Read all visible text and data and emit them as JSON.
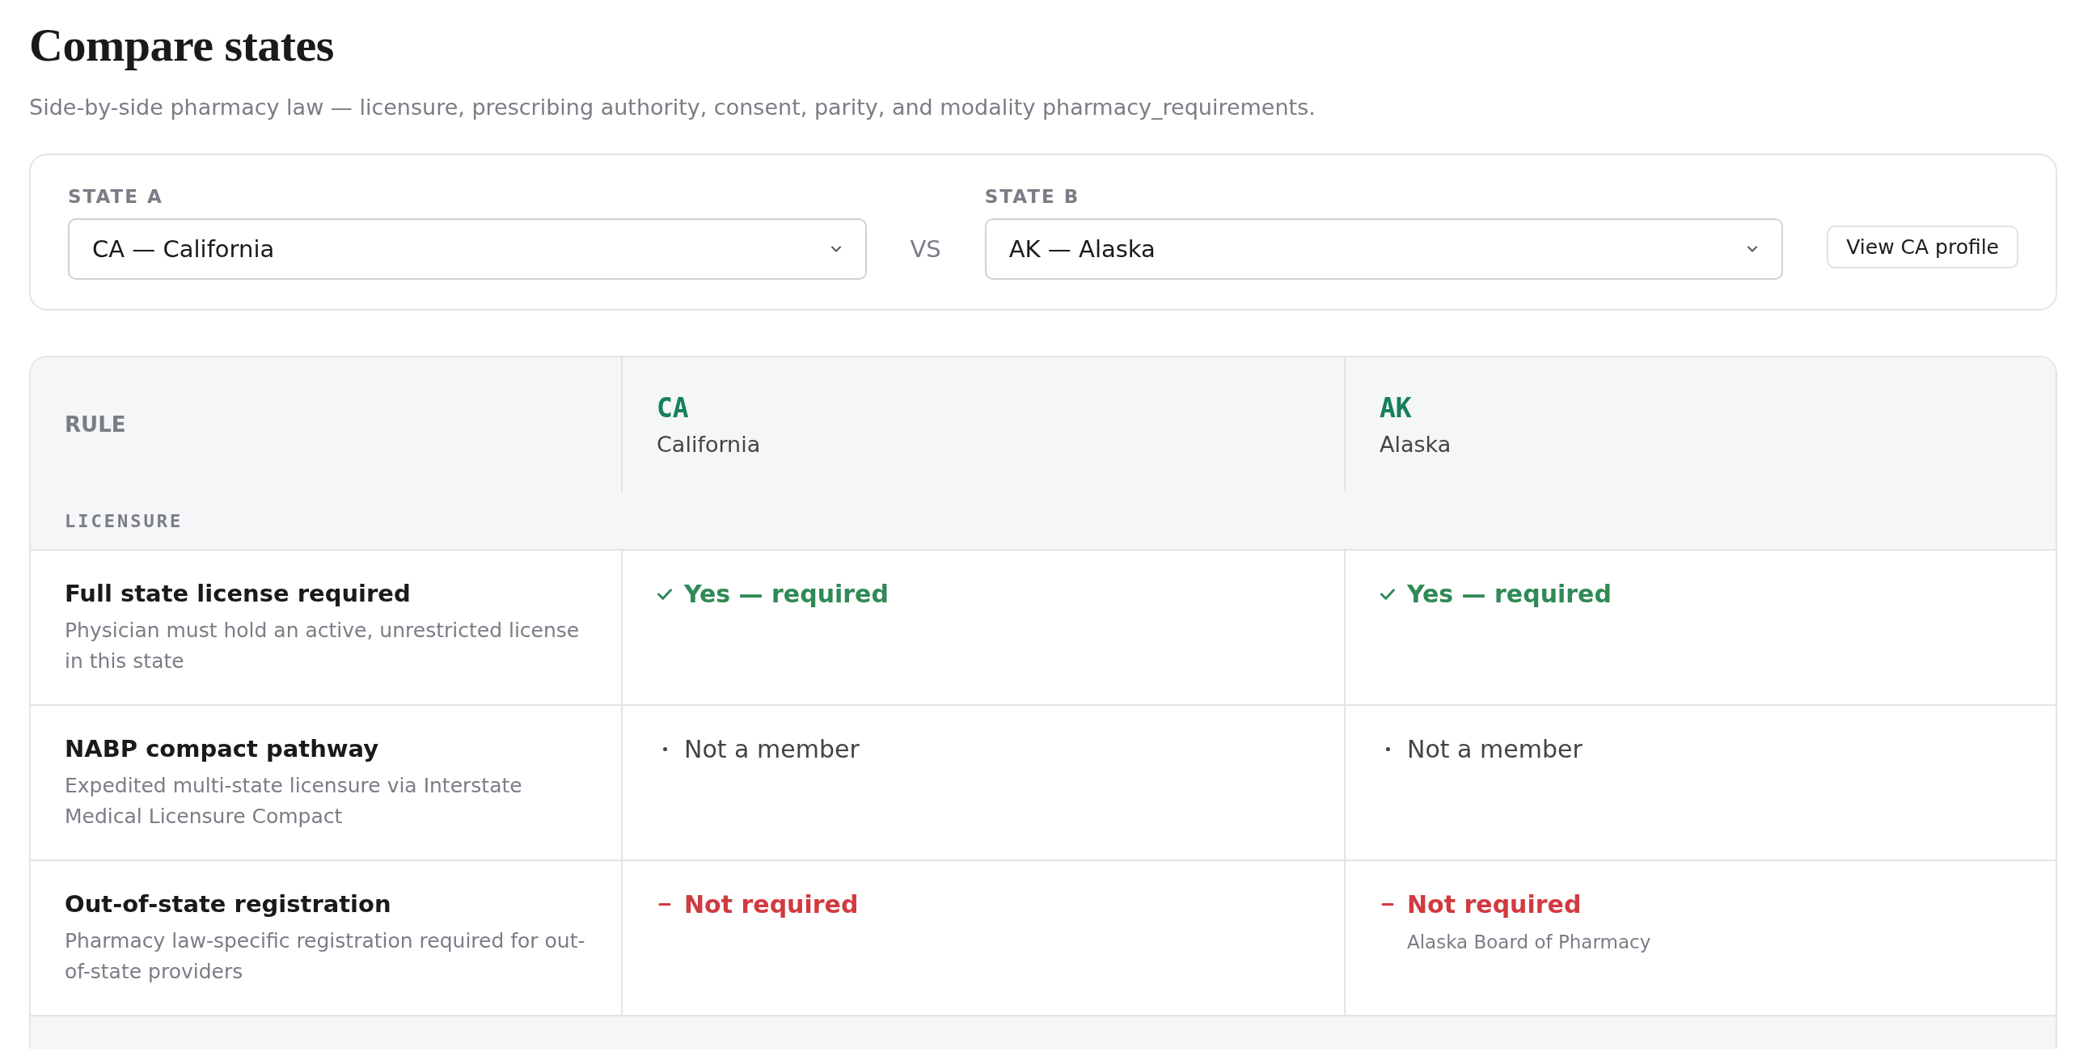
{
  "page": {
    "title": "Compare states",
    "subtitle": "Side-by-side pharmacy law — licensure, prescribing authority, consent, parity, and modality pharmacy_requirements."
  },
  "selector": {
    "state_a": {
      "label": "STATE A",
      "value": "CA — California"
    },
    "vs": "VS",
    "state_b": {
      "label": "STATE B",
      "value": "AK — Alaska"
    },
    "profile_button": "View CA profile"
  },
  "table": {
    "rule_heading": "RULE",
    "columns": [
      {
        "code": "CA",
        "name": "California"
      },
      {
        "code": "AK",
        "name": "Alaska"
      }
    ],
    "sections": [
      {
        "title": "LICENSURE",
        "rows": [
          {
            "rule": "Full state license required",
            "description": "Physician must hold an active, unrestricted license in this state",
            "cells": [
              {
                "kind": "yes",
                "text": "Yes — required"
              },
              {
                "kind": "yes",
                "text": "Yes — required"
              }
            ]
          },
          {
            "rule": "NABP compact pathway",
            "description": "Expedited multi-state licensure via Interstate Medical Licensure Compact",
            "cells": [
              {
                "kind": "neutral",
                "text": "Not a member"
              },
              {
                "kind": "neutral",
                "text": "Not a member"
              }
            ]
          },
          {
            "rule": "Out-of-state registration",
            "description": "Pharmacy law-specific registration required for out-of-state providers",
            "cells": [
              {
                "kind": "no",
                "text": "Not required"
              },
              {
                "kind": "no",
                "text": "Not required",
                "note": "Alaska Board of Pharmacy"
              }
            ]
          }
        ]
      }
    ]
  }
}
